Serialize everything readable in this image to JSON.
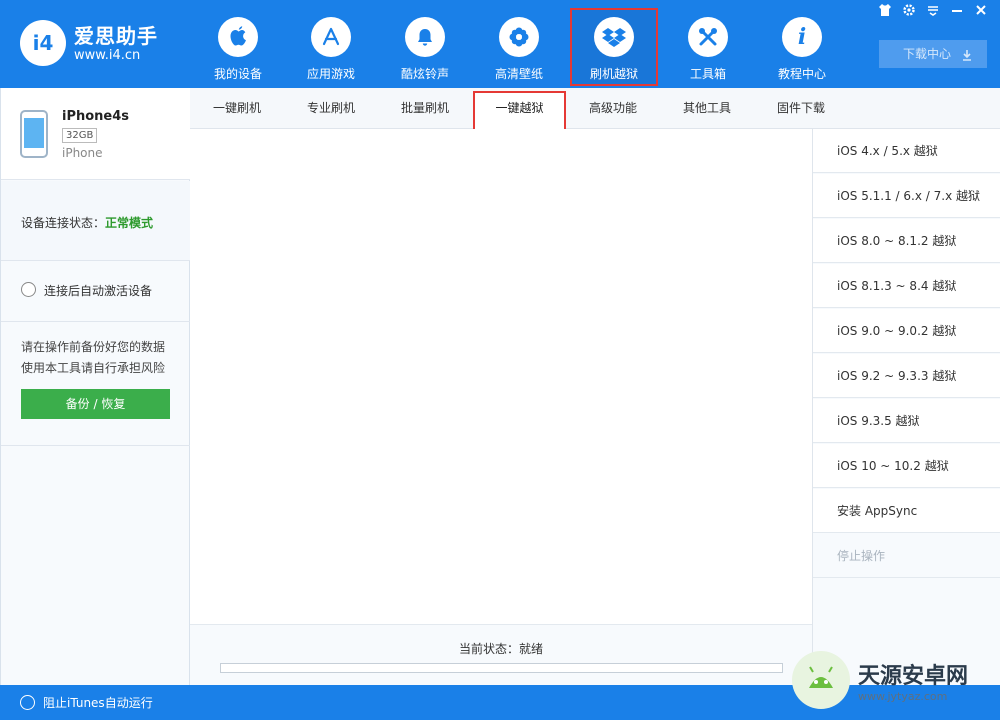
{
  "header": {
    "logo_badge": "i4",
    "logo_name": "爱思助手",
    "logo_url": "www.i4.cn",
    "nav": [
      {
        "label": "我的设备",
        "icon": "apple-icon"
      },
      {
        "label": "应用游戏",
        "icon": "app-store-icon"
      },
      {
        "label": "酷炫铃声",
        "icon": "bell-icon"
      },
      {
        "label": "高清壁纸",
        "icon": "flower-icon"
      },
      {
        "label": "刷机越狱",
        "icon": "dropbox-box-icon",
        "active": true
      },
      {
        "label": "工具箱",
        "icon": "tools-icon"
      },
      {
        "label": "教程中心",
        "icon": "info-icon"
      }
    ],
    "download_label": "下载中心",
    "window_controls": [
      "shirt-icon",
      "gear-icon",
      "menu-icon",
      "minimize-icon",
      "close-icon"
    ]
  },
  "device": {
    "name": "iPhone4s",
    "capacity": "32GB",
    "type": "iPhone"
  },
  "sidebar": {
    "conn_label": "设备连接状态：",
    "conn_value": "正常模式",
    "auto_activate_label": "连接后自动激活设备",
    "warning_line1": "请在操作前备份好您的数据",
    "warning_line2": "使用本工具请自行承担风险",
    "backup_button": "备份 / 恢复"
  },
  "subtabs": [
    {
      "label": "一键刷机"
    },
    {
      "label": "专业刷机"
    },
    {
      "label": "批量刷机"
    },
    {
      "label": "一键越狱",
      "active": true
    },
    {
      "label": "高级功能"
    },
    {
      "label": "其他工具"
    },
    {
      "label": "固件下载"
    }
  ],
  "main": {
    "status_text": "当前状态：就绪",
    "progress": 0
  },
  "right_panel": [
    {
      "label": "iOS 4.x / 5.x 越狱"
    },
    {
      "label": "iOS 5.1.1 / 6.x / 7.x 越狱"
    },
    {
      "label": "iOS 8.0 ~ 8.1.2 越狱"
    },
    {
      "label": "iOS 8.1.3 ~ 8.4 越狱"
    },
    {
      "label": "iOS 9.0 ~ 9.0.2 越狱"
    },
    {
      "label": "iOS 9.2 ~ 9.3.3 越狱"
    },
    {
      "label": "iOS 9.3.5 越狱"
    },
    {
      "label": "iOS 10 ~ 10.2 越狱"
    },
    {
      "label": "安装 AppSync"
    },
    {
      "label": "停止操作",
      "disabled": true
    }
  ],
  "footer": {
    "itunes_label": "阻止iTunes自动运行"
  },
  "watermark": {
    "title": "天源安卓网",
    "url": "www.jytyaz.com"
  },
  "colors": {
    "brand_blue": "#1a80e8",
    "highlight_red": "#e53935",
    "success_green": "#3bae4b"
  }
}
